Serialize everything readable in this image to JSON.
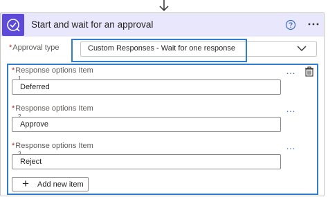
{
  "flow_arrow_icon": "arrow-down-icon",
  "action": {
    "title": "Start and wait for an approval",
    "icon": "approval-icon",
    "help_icon": "question-circle-icon",
    "menu_icon": "more-options-icon",
    "accent_color": "#5d4ad8",
    "header_bg": "#e9e7fb"
  },
  "approval_type": {
    "required_mark": "*",
    "label": "Approval type",
    "value": "Custom Responses - Wait for one response"
  },
  "response_options": {
    "items": [
      {
        "required_mark": "*",
        "label": "Response options Item",
        "index": "1",
        "value": "Deferred",
        "more": "…"
      },
      {
        "required_mark": "*",
        "label": "Response options Item",
        "index": "2",
        "value": "Approve",
        "more": "…"
      },
      {
        "required_mark": "*",
        "label": "Response options Item",
        "index": "3",
        "value": "Reject",
        "more": "…"
      }
    ],
    "delete_icon": "delete-icon",
    "add_button": {
      "plus": "+",
      "label": "Add new item"
    }
  },
  "highlight_color": "#2f7dce"
}
